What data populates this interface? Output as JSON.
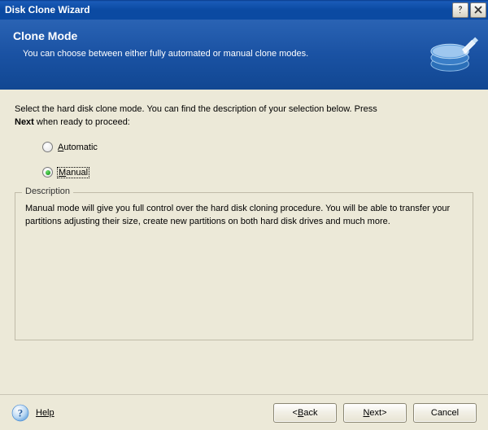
{
  "window": {
    "title": "Disk Clone Wizard"
  },
  "banner": {
    "title": "Clone Mode",
    "subtitle": "You can choose between either fully automated or manual clone modes."
  },
  "instructions": {
    "line1": "Select the hard disk clone mode. You can find the description of your selection below. Press",
    "nextWord": "Next",
    "line2_rest": " when ready to proceed:"
  },
  "options": {
    "automatic": {
      "label": "Automatic",
      "accessPrefix": "A",
      "rest": "utomatic",
      "checked": false
    },
    "manual": {
      "label": "Manual",
      "accessPrefix": "M",
      "rest": "anual",
      "checked": true
    }
  },
  "description": {
    "legend": "Description",
    "text": "Manual mode will give you full control over the hard disk cloning procedure. You will be able to transfer your partitions adjusting their size, create new partitions on both hard disk drives and much more."
  },
  "footer": {
    "help": "Help",
    "back_prefix": "< ",
    "back": "Back",
    "next": "Next",
    "next_suffix": " >",
    "cancel": "Cancel"
  }
}
